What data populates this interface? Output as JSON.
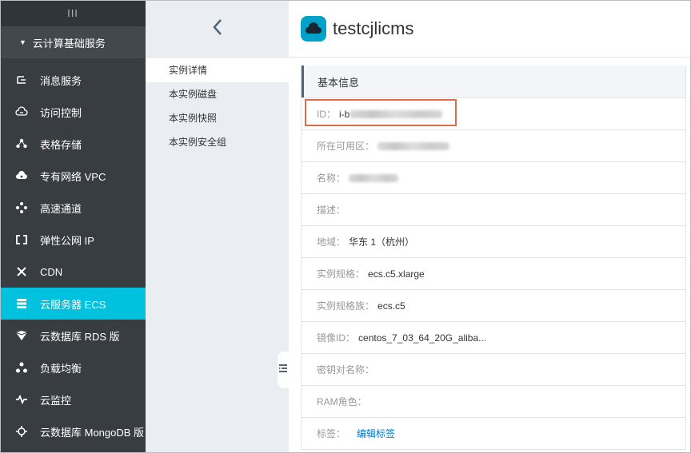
{
  "sidebar": {
    "collapse_glyph": "III",
    "group_label": "云计算基础服务",
    "items": [
      {
        "label": "消息服务",
        "icon": "message-icon"
      },
      {
        "label": "访问控制",
        "icon": "cloud-key-icon"
      },
      {
        "label": "表格存储",
        "icon": "table-store-icon"
      },
      {
        "label": "专有网络 VPC",
        "icon": "cloud-network-icon"
      },
      {
        "label": "高速通道",
        "icon": "express-connect-icon"
      },
      {
        "label": "弹性公网 IP",
        "icon": "eip-icon"
      },
      {
        "label": "CDN",
        "icon": "cdn-icon"
      },
      {
        "label": "云服务器 ECS",
        "icon": "server-icon",
        "active": true
      },
      {
        "label": "云数据库 RDS 版",
        "icon": "rds-icon"
      },
      {
        "label": "负载均衡",
        "icon": "load-balancer-icon"
      },
      {
        "label": "云监控",
        "icon": "monitor-icon"
      },
      {
        "label": "云数据库 MongoDB 版",
        "icon": "mongodb-icon"
      }
    ]
  },
  "subnav": {
    "items": [
      {
        "label": "实例详情",
        "active": true
      },
      {
        "label": "本实例磁盘"
      },
      {
        "label": "本实例快照"
      },
      {
        "label": "本实例安全组"
      }
    ]
  },
  "header": {
    "title": "testcjlicms"
  },
  "details": {
    "section_title": "基本信息",
    "id_label": "ID：",
    "id_value": "i-b",
    "zone_label": "所在可用区：",
    "name_label": "名称：",
    "desc_label": "描述：",
    "region_label": "地域：",
    "region_value": "华东 1（杭州）",
    "spec_label": "实例规格：",
    "spec_value": "ecs.c5.xlarge",
    "family_label": "实例规格族：",
    "family_value": "ecs.c5",
    "image_label": "镜像ID：",
    "image_value": "centos_7_03_64_20G_aliba...",
    "keypair_label": "密钥对名称：",
    "ram_label": "RAM角色：",
    "tags_label": "标签：",
    "tags_link": "编辑标签"
  },
  "colors": {
    "sidebar_bg": "#373d41",
    "active_item": "#00c1de",
    "link": "#0077cc",
    "highlight_box": "#e06c4a"
  }
}
